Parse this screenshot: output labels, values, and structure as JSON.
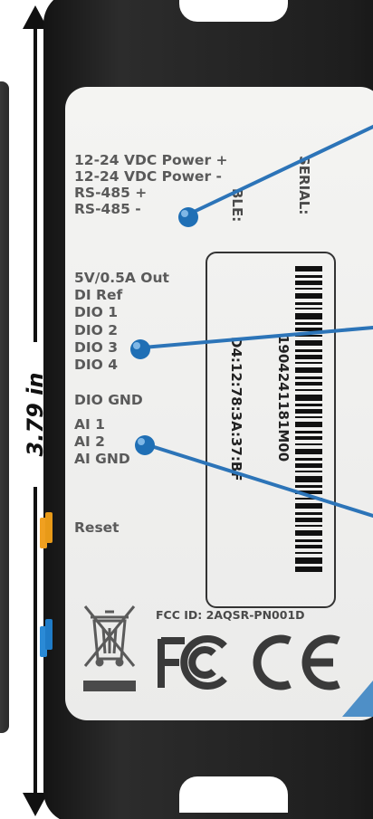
{
  "measurement": {
    "label": "3.79 in"
  },
  "pin_labels": [
    "12-24 VDC Power +",
    "12-24 VDC Power -",
    "RS-485 +",
    "RS-485 -",
    "5V/0.5A Out",
    "DI Ref",
    "DIO 1",
    "DIO 2",
    "DIO 3",
    "DIO 4",
    "DIO GND",
    "AI 1",
    "AI 2",
    "AI GND",
    "Reset"
  ],
  "vertical_labels": {
    "serial": "SERIAL:",
    "ble": "BLE:",
    "serial_number": "1904241181M00",
    "ble_mac": "D4:12:78:3A:37:BF"
  },
  "fcc_id": "FCC ID: 2AQSR-PN001D",
  "colors": {
    "device": "#1e1e1e",
    "label": "#f0f0ee",
    "label_text": "#5a5a5a",
    "callout_ball": "#1f6fb5",
    "side_button_orange": "#f0a020",
    "side_button_blue": "#2a8ad6"
  },
  "icons": [
    "weee-crossed-bin-icon",
    "fcc-logo-icon",
    "ce-mark-icon"
  ]
}
